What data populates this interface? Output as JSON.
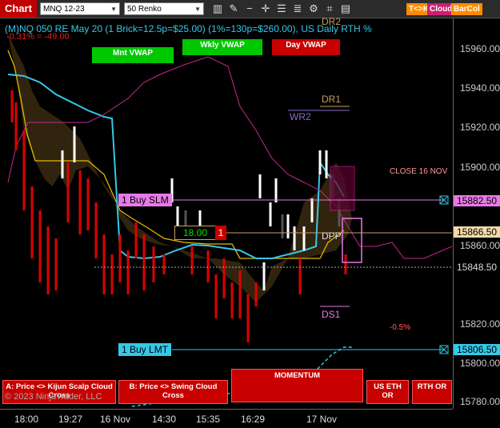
{
  "toolbar": {
    "title": "Chart",
    "instrument": "MNQ 12-23",
    "bar_type": "50 Renko",
    "icons": [
      "bar-style-icon",
      "drawing-tool-icon",
      "zoom-out-icon",
      "crosshair-icon",
      "properties-icon",
      "instruments-icon",
      "strategies-icon",
      "attach-icon",
      "templates-icon"
    ],
    "buttons": [
      {
        "label": "T<>K",
        "color": "#ff8c00"
      },
      {
        "label": "Cloud",
        "color": "#cc1f6f"
      },
      {
        "label": "BarCol",
        "color": "#ff8c00"
      }
    ]
  },
  "chart": {
    "info": "(M)NQ 050 RE May 20 (1 Brick=12.5p=$25.00) (1%=130p=$260.00), US Daily RTH %",
    "pnl": "-0.31% = -49.00",
    "vwap_buttons": [
      {
        "label": "Mnt VWAP",
        "color": "#00c800"
      },
      {
        "label": "Wkly VWAP",
        "color": "#00c800"
      },
      {
        "label": "Day VWAP",
        "color": "#c80000"
      }
    ],
    "levels": {
      "dr2": "DR2",
      "dr1": "DR1",
      "wr2": "WR2",
      "dpp": "DPP",
      "ds1": "DS1",
      "close": "CLOSE 16 NOV",
      "pct": "-0.5%"
    },
    "orders": {
      "buy_slm": "1 Buy SLM",
      "buy_lmt": "1 Buy LMT",
      "position_price": "18.00",
      "position_qty": "1"
    },
    "bottom_buttons": [
      "A: Price <> Kijun Scalp Cloud Cross",
      "B: Price <> Swing Cloud Cross",
      "MOMENTUM",
      "US ETH OR",
      "RTH OR"
    ],
    "copyright": "© 2023 NinjaTrader, LLC"
  },
  "price_axis": {
    "ticks": [
      "15960.00",
      "15940.00",
      "15920.00",
      "15900.00",
      "15860.00",
      "15820.00",
      "15800.00",
      "15780.00"
    ],
    "tags": [
      {
        "label": "15882.50",
        "color": "#e879e8"
      },
      {
        "label": "15866.50",
        "color": "#f3d9a8"
      },
      {
        "label": "15848.50",
        "color": "#000000"
      },
      {
        "label": "15806.50",
        "color": "#35c8e8"
      }
    ]
  },
  "time_axis": {
    "labels": [
      "18:00",
      "19:27",
      "16 Nov",
      "14:30",
      "15:35",
      "16:29",
      "17 Nov"
    ]
  }
}
